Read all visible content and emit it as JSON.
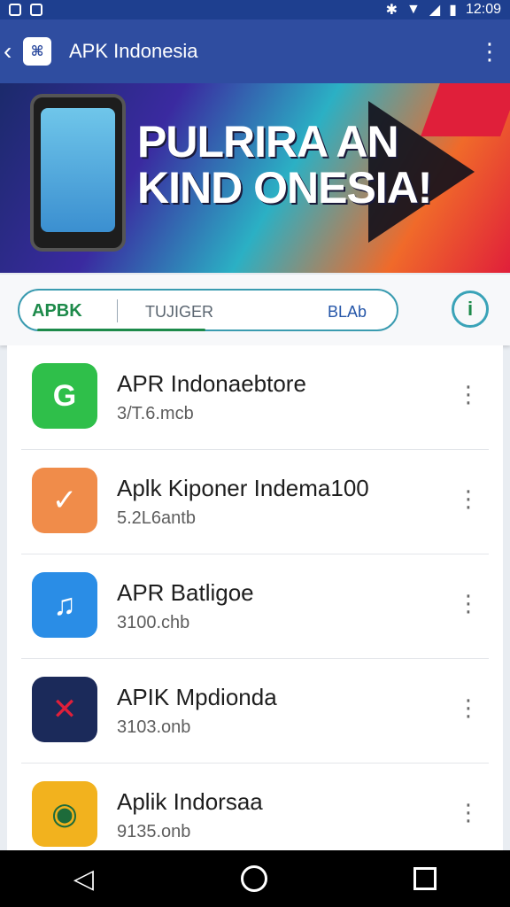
{
  "status_bar": {
    "time": "12:09"
  },
  "app_bar": {
    "title": "APK Indonesia",
    "logo_text": "⌘"
  },
  "banner": {
    "line1": "PULRIRA AN",
    "line2": "KIND ONESIA!"
  },
  "search": {
    "tab_left": "APBK",
    "tab_middle": "TUJIGER",
    "tab_right": "BLAb"
  },
  "apps": [
    {
      "name": "APR Indonaebtore",
      "size": "3/T.6.mcb",
      "icon": "green-app-icon",
      "color": "#2fbf4a"
    },
    {
      "name": "Aplk Kiponer Indema100",
      "size": "5.2L6antb",
      "icon": "blue-swoosh-app-icon",
      "color": "#f08c4a"
    },
    {
      "name": "APR Batligoe",
      "size": "3100.chb",
      "icon": "music-note-app-icon",
      "color": "#2a8de6"
    },
    {
      "name": "APIK Mpdionda",
      "size": "3103.onb",
      "icon": "red-app-icon",
      "color": "#1b2a5a"
    },
    {
      "name": "Aplik Indorsaa",
      "size": "9135.onb",
      "icon": "camera-app-icon",
      "color": "#f2b21e"
    }
  ]
}
